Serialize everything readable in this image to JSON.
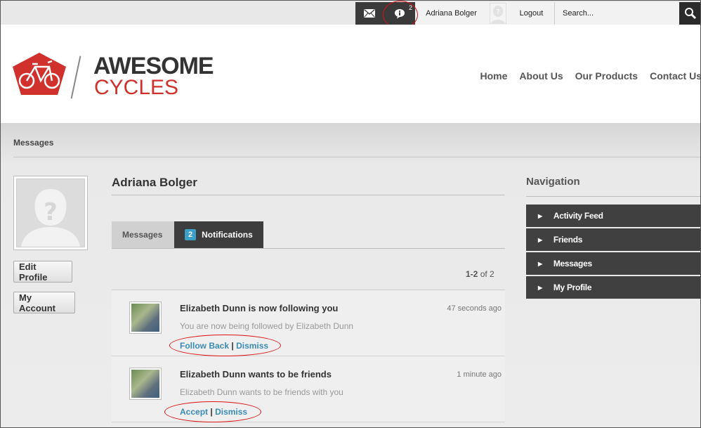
{
  "topbar": {
    "notification_count": "2",
    "user_name": "Adriana Bolger",
    "logout_label": "Logout",
    "search_placeholder": "Search..."
  },
  "logo": {
    "word1": "AWESOME",
    "word2": "CYCLES"
  },
  "nav": {
    "items": [
      {
        "label": "Home"
      },
      {
        "label": "About Us"
      },
      {
        "label": "Our Products"
      },
      {
        "label": "Contact Us"
      }
    ]
  },
  "breadcrumb": "Messages",
  "profile": {
    "name": "Adriana Bolger",
    "edit_label": "Edit Profile",
    "account_label": "My Account"
  },
  "tabs": {
    "messages_label": "Messages",
    "notifications_badge": "2",
    "notifications_label": "Notifications"
  },
  "pager": {
    "range": "1-2",
    "of_text": "of 2"
  },
  "notifications": [
    {
      "title": "Elizabeth Dunn is now following you",
      "time": "47 seconds ago",
      "text": "You are now being followed by Elizabeth Dunn",
      "action1": "Follow Back",
      "separator": "|",
      "action2": "Dismiss"
    },
    {
      "title": "Elizabeth Dunn wants to be friends",
      "time": "1 minute ago",
      "text": "Elizabeth Dunn wants to be friends with you",
      "action1": "Accept",
      "separator": "|",
      "action2": "Dismiss"
    }
  ],
  "sidebar": {
    "title": "Navigation",
    "items": [
      {
        "label": "Activity Feed"
      },
      {
        "label": "Friends"
      },
      {
        "label": "Messages"
      },
      {
        "label": "My Profile"
      }
    ]
  },
  "colors": {
    "brand_red": "#d0312d",
    "link_blue": "#3b8bb5",
    "badge_blue": "#3aa0c8",
    "dark_bar": "#3a3a3a",
    "annotation_red": "#dd1111"
  }
}
